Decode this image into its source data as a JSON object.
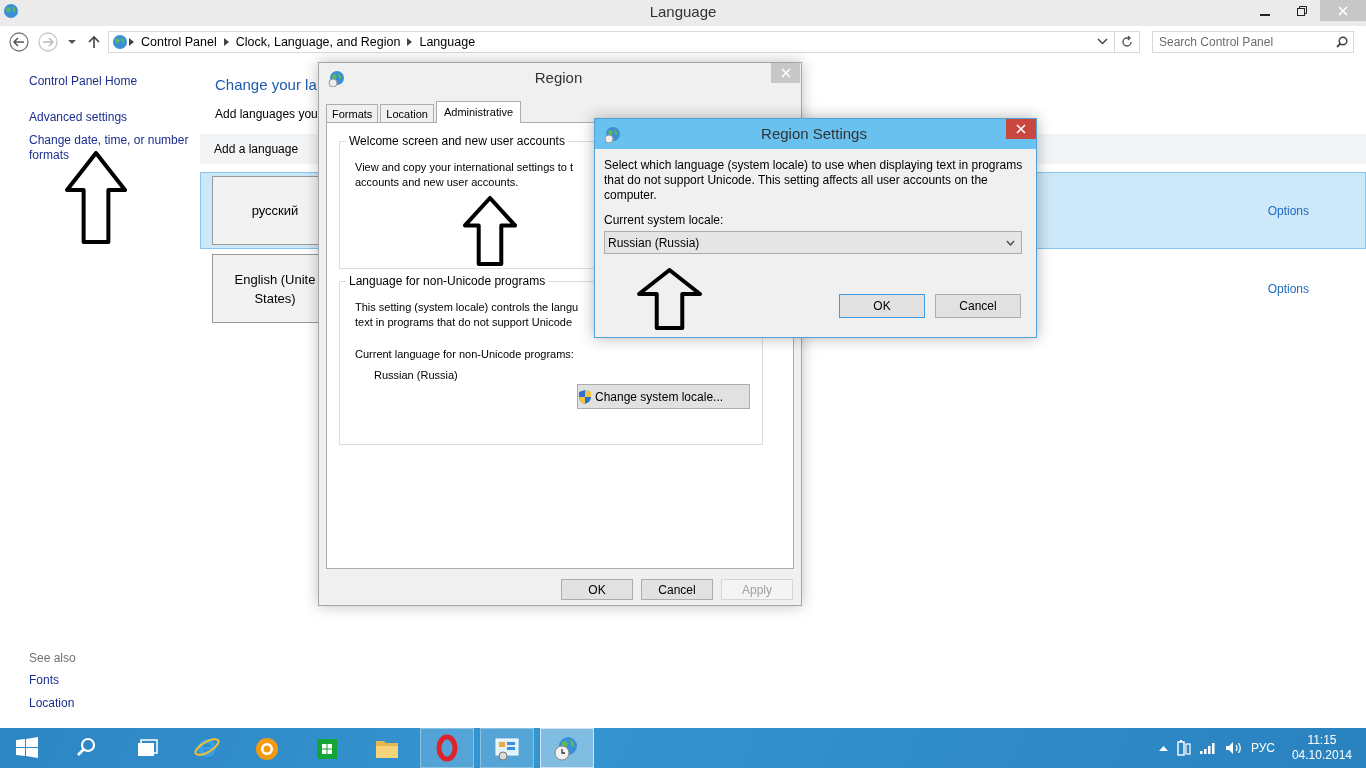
{
  "window": {
    "title": "Language"
  },
  "address_bar": {
    "breadcrumbs": [
      "Control Panel",
      "Clock, Language, and Region",
      "Language"
    ],
    "search": {
      "placeholder": "Search Control Panel"
    }
  },
  "sidebar": {
    "links": [
      "Control Panel Home",
      "Advanced settings",
      "Change date, time, or number formats"
    ],
    "see_also": {
      "heading": "See also",
      "links": [
        "Fonts",
        "Location"
      ]
    }
  },
  "main": {
    "heading": "Change your la",
    "intro": "Add languages you",
    "toolbar": [
      "Add a language"
    ],
    "languages": [
      {
        "name": "русский",
        "options": "Options",
        "selected": true
      },
      {
        "name": "English (Unite\nStates)",
        "options": "Options",
        "selected": false
      }
    ]
  },
  "region_dialog": {
    "title": "Region",
    "tabs": [
      {
        "label": "Formats",
        "selected": false
      },
      {
        "label": "Location",
        "selected": false
      },
      {
        "label": "Administrative",
        "selected": true
      }
    ],
    "groups": [
      {
        "title": "Welcome screen and new user accounts",
        "lines": [
          "View and copy your international settings to t",
          "accounts and new user accounts."
        ]
      },
      {
        "title": "Language for non-Unicode programs",
        "lines": [
          "This setting (system locale) controls the langu",
          "text in programs that do not support Unicode"
        ],
        "current_label": "Current language for non-Unicode programs:",
        "current_value": "Russian (Russia)",
        "button": "Change system locale..."
      }
    ],
    "buttons": [
      {
        "label": "OK",
        "disabled": false
      },
      {
        "label": "Cancel",
        "disabled": false
      },
      {
        "label": "Apply",
        "disabled": true
      }
    ]
  },
  "region_settings_dialog": {
    "title": "Region Settings",
    "description": "Select which language (system locale) to use when displaying text in programs that do not support Unicode. This setting affects all user accounts on the computer.",
    "locale_label": "Current system locale:",
    "locale": {
      "value": "Russian (Russia)"
    },
    "buttons": [
      {
        "label": "OK",
        "default": true
      },
      {
        "label": "Cancel",
        "default": false
      }
    ]
  },
  "taskbar": {
    "apps": [
      {
        "kind": "start",
        "running": false,
        "selected": false
      },
      {
        "kind": "search",
        "running": false,
        "selected": false
      },
      {
        "kind": "desktop",
        "running": false,
        "selected": false
      },
      {
        "kind": "browser",
        "running": false,
        "selected": false
      },
      {
        "kind": "ball",
        "running": false,
        "selected": false
      },
      {
        "kind": "store",
        "running": false,
        "selected": false
      },
      {
        "kind": "folder",
        "running": false,
        "selected": false
      },
      {
        "kind": "opera",
        "running": true,
        "selected": false
      },
      {
        "kind": "panel",
        "running": true,
        "selected": false
      },
      {
        "kind": "region",
        "running": true,
        "selected": true
      }
    ],
    "tray": {
      "language": "РУС",
      "time": "11:15",
      "date": "04.10.2014"
    }
  }
}
